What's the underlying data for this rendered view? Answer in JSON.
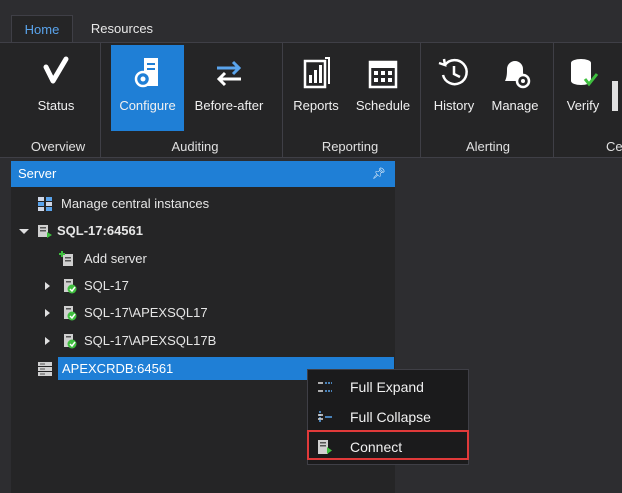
{
  "tabs": [
    {
      "label": "Home",
      "active": true
    },
    {
      "label": "Resources",
      "active": false
    }
  ],
  "ribbon": {
    "buttons": {
      "status": "Status",
      "configure": "Configure",
      "before_after": "Before-after",
      "reports": "Reports",
      "schedule": "Schedule",
      "history": "History",
      "manage": "Manage",
      "verify": "Verify"
    },
    "groups": {
      "overview": "Overview",
      "auditing": "Auditing",
      "reporting": "Reporting",
      "alerting": "Alerting",
      "cut": "Ce"
    },
    "selected_button": "Configure"
  },
  "server_panel": {
    "title": "Server",
    "pin_icon": "pin-icon",
    "tree": {
      "manage_central": "Manage central instances",
      "root": "SQL-17:64561",
      "add_server": "Add server",
      "children": [
        "SQL-17",
        "SQL-17\\APEXSQL17",
        "SQL-17\\APEXSQL17B"
      ],
      "other_root": "APEXCRDB:64561"
    }
  },
  "context_menu": {
    "items": [
      "Full Expand",
      "Full Collapse",
      "Connect"
    ],
    "highlighted": "Connect"
  },
  "colors": {
    "accent": "#1f7fd6",
    "highlight_border": "#e13a3a",
    "background": "#2d2d30",
    "green_status": "#3fbf3f"
  }
}
